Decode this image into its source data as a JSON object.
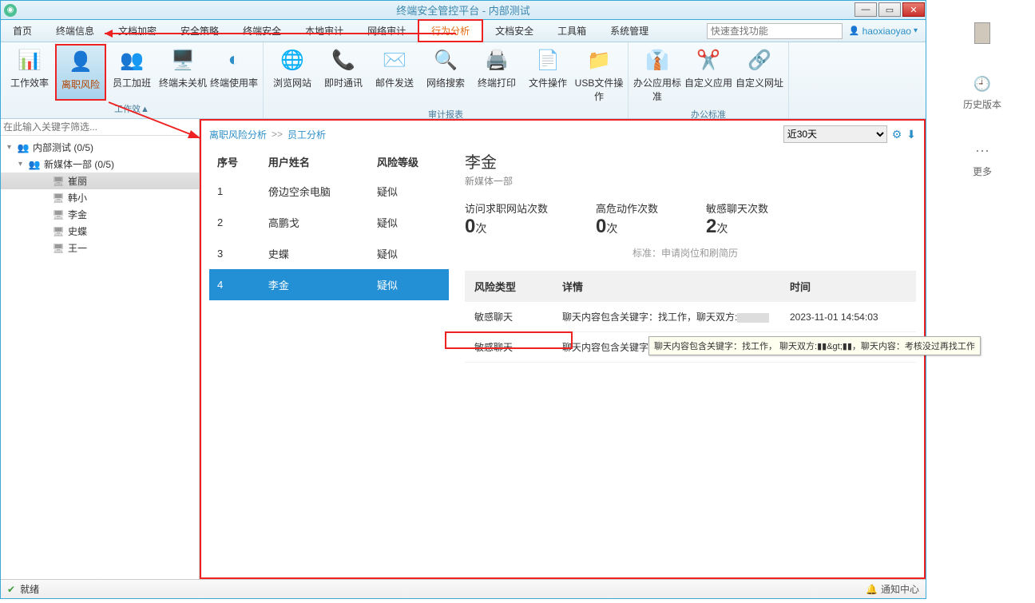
{
  "window_title": "终端安全管控平台 - 内部测试",
  "menu": [
    "首页",
    "终端信息",
    "文档加密",
    "安全策略",
    "终端安全",
    "本地审计",
    "网络审计",
    "行为分析",
    "文档安全",
    "工具箱",
    "系统管理"
  ],
  "menu_active_index": 7,
  "search_placeholder": "快速查找功能",
  "user": "haoxiaoyao",
  "ribbon": {
    "groups": [
      {
        "label": "工作效▲",
        "items": [
          {
            "label": "工作效率",
            "icon": "📊"
          },
          {
            "label": "离职风险",
            "icon": "👤",
            "highlight": true
          },
          {
            "label": "员工加班",
            "icon": "👥"
          },
          {
            "label": "终端未关机",
            "icon": "🖥️"
          },
          {
            "label": "终端使用率",
            "icon": "◐"
          }
        ]
      },
      {
        "label": "审计报表",
        "items": [
          {
            "label": "浏览网站",
            "icon": "🌐"
          },
          {
            "label": "即时通讯",
            "icon": "📞"
          },
          {
            "label": "邮件发送",
            "icon": "✉️"
          },
          {
            "label": "网络搜索",
            "icon": "🔍"
          },
          {
            "label": "终端打印",
            "icon": "🖨️"
          },
          {
            "label": "文件操作",
            "icon": "📄"
          },
          {
            "label": "USB文件操作",
            "icon": "📁"
          }
        ]
      },
      {
        "label": "办公标准",
        "items": [
          {
            "label": "办公应用标准",
            "icon": "👔"
          },
          {
            "label": "自定义应用",
            "icon": "✂️"
          },
          {
            "label": "自定义网址",
            "icon": "🔗"
          }
        ]
      }
    ]
  },
  "sidebar": {
    "filter_placeholder": "在此输入关键字筛选...",
    "root": {
      "label": "内部测试 (0/5)"
    },
    "group": {
      "label": "新媒体一部 (0/5)"
    },
    "members": [
      "崔丽",
      "韩小",
      "李金",
      "史蝶",
      "王一"
    ],
    "selected_index": 0
  },
  "crumb": {
    "a": "离职风险分析",
    "sep": ">>",
    "b": "员工分析",
    "range": "近30天"
  },
  "list": {
    "cols": [
      "序号",
      "用户姓名",
      "风险等级"
    ],
    "rows": [
      {
        "n": "1",
        "name": "傍边空余电脑",
        "risk": "疑似"
      },
      {
        "n": "2",
        "name": "高鹏戈",
        "risk": "疑似"
      },
      {
        "n": "3",
        "name": "史蝶",
        "risk": "疑似"
      },
      {
        "n": "4",
        "name": "李金",
        "risk": "疑似"
      }
    ],
    "selected_index": 3
  },
  "detail": {
    "name": "李金",
    "dept": "新媒体一部",
    "stats": [
      {
        "label": "访问求职网站次数",
        "value": "0",
        "unit": "次"
      },
      {
        "label": "高危动作次数",
        "value": "0",
        "unit": "次"
      },
      {
        "label": "敏感聊天次数",
        "value": "2",
        "unit": "次"
      }
    ],
    "standard": "标准：申请岗位和刷简历",
    "table_cols": [
      "风险类型",
      "详情",
      "时间"
    ],
    "table_rows": [
      {
        "type": "敏感聊天",
        "detail": "聊天内容包含关键字：找工作，聊天双方:",
        "time": "2023-11-01 14:54:03"
      },
      {
        "type": "敏感聊天",
        "detail": "聊天内容包含关键字：",
        "time": ""
      }
    ]
  },
  "tooltip": "聊天内容包含关键字：找工作，  聊天双方:▮▮&gt;▮▮，聊天内容：考核没过再找工作",
  "status": {
    "text": "就绪",
    "notify": "通知中心"
  },
  "side": {
    "history": "历史版本",
    "more": "更多"
  }
}
